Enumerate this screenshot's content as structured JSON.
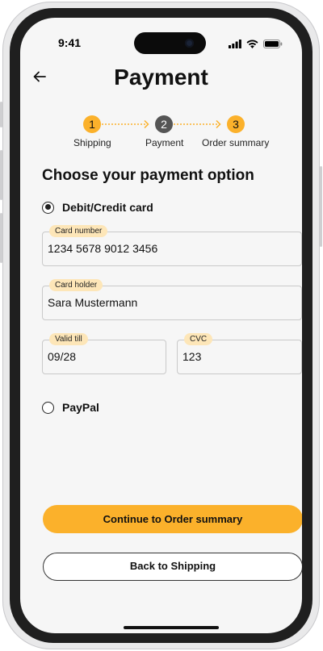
{
  "status_bar": {
    "time": "9:41"
  },
  "header": {
    "title": "Payment"
  },
  "stepper": {
    "steps": [
      {
        "number": "1",
        "label": "Shipping",
        "state": "done"
      },
      {
        "number": "2",
        "label": "Payment",
        "state": "current"
      },
      {
        "number": "3",
        "label": "Order summary",
        "state": "upcoming"
      }
    ]
  },
  "section": {
    "heading": "Choose your payment option"
  },
  "payment_options": {
    "card": {
      "label": "Debit/Credit card",
      "selected": true
    },
    "paypal": {
      "label": "PayPal",
      "selected": false
    }
  },
  "card_form": {
    "card_number": {
      "label": "Card number",
      "value": "1234 5678 9012 3456"
    },
    "card_holder": {
      "label": "Card holder",
      "value": "Sara Mustermann"
    },
    "valid_till": {
      "label": "Valid till",
      "value": "09/28"
    },
    "cvc": {
      "label": "CVC",
      "value": "123"
    }
  },
  "actions": {
    "continue_label": "Continue to Order summary",
    "back_label": "Back to Shipping"
  },
  "colors": {
    "accent": "#fbb12b",
    "label_bg": "#fde6b8",
    "current_step": "#555555",
    "screen_bg": "#f6f6f6"
  },
  "icons": {
    "back": "arrow-left-icon",
    "signal": "cellular-signal-icon",
    "wifi": "wifi-icon",
    "battery": "battery-icon"
  }
}
